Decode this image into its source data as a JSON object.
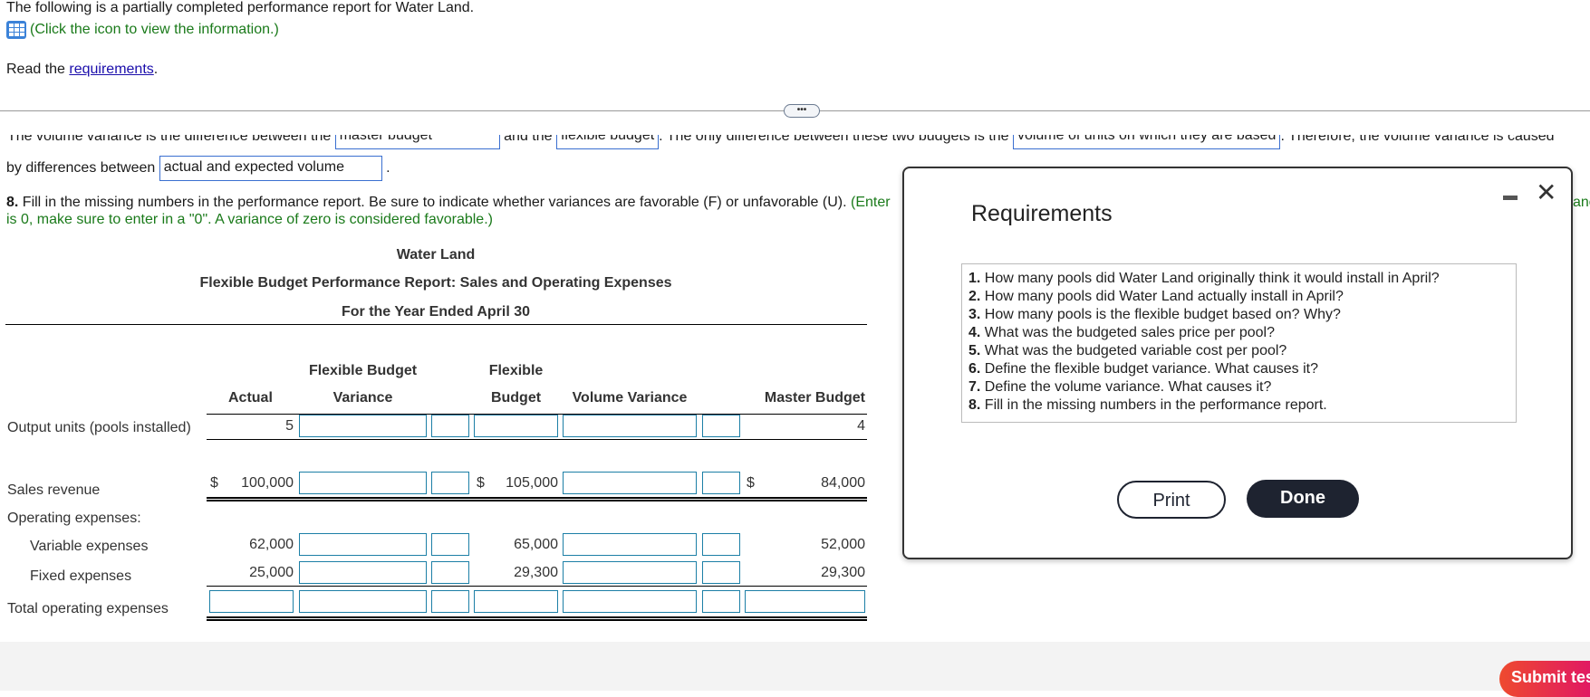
{
  "intro": {
    "text": "The following is a partially completed performance report for Water Land.",
    "info_link": "(Click the icon to view the information.)",
    "read_prefix": "Read the ",
    "requirements_link": "requirements",
    "read_suffix": "."
  },
  "q7": {
    "clipped_parts": [
      "The volume variance is the difference between the ",
      " and the ",
      ". The only difference between these two budgets is the ",
      ". Therefore, the volume variance is caused"
    ],
    "answers": [
      "master budget",
      "flexible budget",
      "volume of units on which they are based"
    ],
    "line2_prefix": "by differences between",
    "answer4": "actual and expected volume",
    "line2_suffix": "."
  },
  "q8": {
    "number": "8.",
    "text": " Fill in the missing numbers in the performance report. Be sure to indicate whether variances are favorable (F) or unfavorable (U). ",
    "green1": "(Enter",
    "green2": "is 0, make sure to enter in a \"0\". A variance of zero is considered favorable.)",
    "cut_right": "anc"
  },
  "report": {
    "company": "Water Land",
    "title": "Flexible Budget Performance Report: Sales and Operating Expenses",
    "period": "For the Year Ended April 30",
    "headers": {
      "actual": "Actual",
      "fbv_1": "Flexible Budget",
      "fbv_2": "Variance",
      "flex_1": "Flexible",
      "flex_2": "Budget",
      "volume": "Volume Variance",
      "master": "Master Budget"
    },
    "currency": "$",
    "rows": {
      "output": {
        "label": "Output units (pools installed)",
        "actual": "5",
        "master": "4"
      },
      "sales": {
        "label": "Sales revenue",
        "actual": "100,000",
        "flexible": "105,000",
        "master": "84,000"
      },
      "opex": {
        "label": "Operating expenses:"
      },
      "variable": {
        "label": "Variable expenses",
        "actual": "62,000",
        "flexible": "65,000",
        "master": "52,000"
      },
      "fixed": {
        "label": "Fixed expenses",
        "actual": "25,000",
        "flexible": "29,300",
        "master": "29,300"
      },
      "total": {
        "label": "Total operating expenses"
      }
    }
  },
  "modal": {
    "title": "Requirements",
    "items": [
      {
        "n": "1.",
        "t": " How many pools did Water Land originally think it would install in April?"
      },
      {
        "n": "2.",
        "t": " How many pools did Water Land actually install in April?"
      },
      {
        "n": "3.",
        "t": " How many pools is the flexible budget based on? Why?"
      },
      {
        "n": "4.",
        "t": " What was the budgeted sales price per pool?"
      },
      {
        "n": "5.",
        "t": " What was the budgeted variable cost per pool?"
      },
      {
        "n": "6.",
        "t": " Define the flexible budget variance. What causes it?"
      },
      {
        "n": "7.",
        "t": " Define the volume variance. What causes it?"
      },
      {
        "n": "8.",
        "t": " Fill in the missing numbers in the performance report."
      }
    ],
    "print": "Print",
    "done": "Done"
  },
  "footer": {
    "submit": "Submit test"
  },
  "colors": {
    "accent": "#1c7fa6",
    "done_bg": "#1e2330",
    "submit_from": "#ee4a2f",
    "submit_to": "#dd0a72",
    "green_text": "#1a7a1a"
  }
}
